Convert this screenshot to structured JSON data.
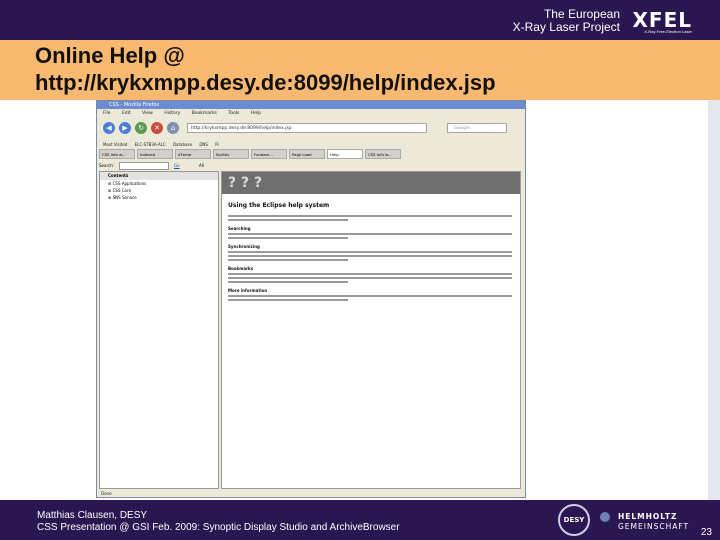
{
  "header": {
    "project_line1": "The European",
    "project_line2": "X-Ray Laser Project",
    "logo": "XFEL",
    "logo_sub": "X-Ray Free-Electron Laser"
  },
  "title": {
    "line1": "Online Help @",
    "line2": "http://krykxmpp.desy.de:8099/help/index.jsp"
  },
  "screenshot": {
    "window_title": "CSS - Mozilla Firefox",
    "menu": [
      "File",
      "Edit",
      "View",
      "History",
      "Bookmarks",
      "Tools",
      "Help"
    ],
    "url": "http://krykxmpp.desy.de:8099/help/index.jsp",
    "search_placeholder": "Google",
    "bookmarks": [
      "Most Visited",
      "ELC-STB3A-ALC",
      "Database",
      "DNS",
      "Pi"
    ],
    "tabs": [
      "CSS Info w...",
      "Indexed",
      "XFerror",
      "Sprites",
      "Fundam...",
      "Page Load",
      "Help",
      "CSS Info w..."
    ],
    "search_label": "Search:",
    "go_label": "Go",
    "scope_label": "All topics",
    "contents_label": "Contents",
    "toc": [
      "CSS Applications",
      "CSS Core",
      "SNS Service"
    ],
    "doc_title": "Using the Eclipse help system",
    "sections": [
      "Searching",
      "Synchronizing",
      "Bookmarks",
      "More information"
    ],
    "status": "Done"
  },
  "footer": {
    "line1": "Matthias Clausen, DESY",
    "line2": "CSS Presentation @ GSI Feb. 2009: Synoptic Display Studio and ArchiveBrowser",
    "desy_logo": "DESY",
    "helmholtz1": "HELMHOLTZ",
    "helmholtz2": "GEMEINSCHAFT",
    "page": "23"
  }
}
